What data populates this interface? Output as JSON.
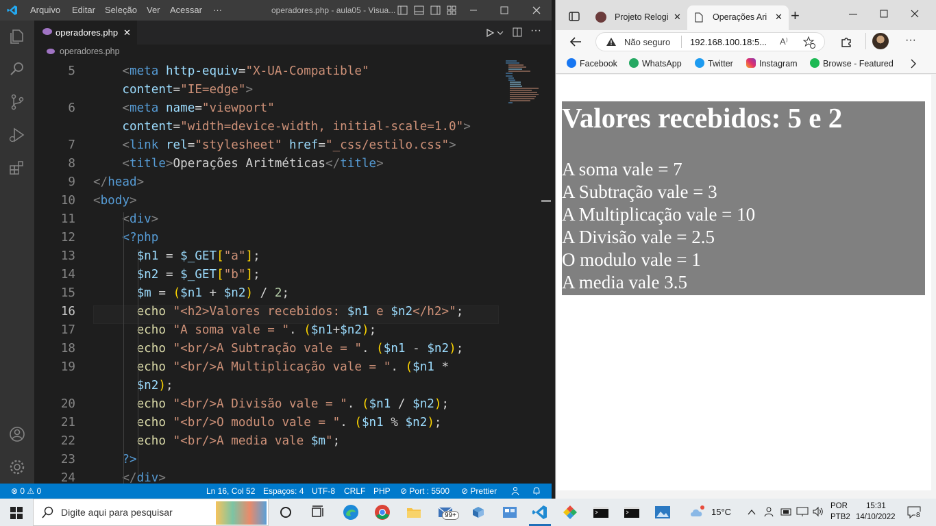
{
  "vscode": {
    "menu": [
      "Arquivo",
      "Editar",
      "Seleção",
      "Ver",
      "Acessar",
      "···"
    ],
    "window_title": "operadores.php - aula05 - Visua...",
    "tab": {
      "label": "operadores.php",
      "close": "✕"
    },
    "breadcrumb": "operadores.php",
    "lines": [
      {
        "num": "5",
        "html": "<span class='p'>&lt;</span><span class='t'>meta</span> <span class='a'>http-equiv</span>=<span class='s'>\"X-UA-Compatible\"</span>"
      },
      {
        "num": "",
        "html": "<span class='a'>content</span>=<span class='s'>\"IE=edge\"</span><span class='p'>&gt;</span>"
      },
      {
        "num": "6",
        "html": "<span class='p'>&lt;</span><span class='t'>meta</span> <span class='a'>name</span>=<span class='s'>\"viewport\"</span>"
      },
      {
        "num": "",
        "html": "<span class='a'>content</span>=<span class='s'>\"width=device-width, initial-scale=1.0\"</span><span class='p'>&gt;</span>"
      },
      {
        "num": "7",
        "html": "<span class='p'>&lt;</span><span class='t'>link</span> <span class='a'>rel</span>=<span class='s'>\"stylesheet\"</span> <span class='a'>href</span>=<span class='s'>\"_css/estilo.css\"</span><span class='p'>&gt;</span>"
      },
      {
        "num": "8",
        "html": "<span class='p'>&lt;</span><span class='t'>title</span><span class='p'>&gt;</span>Operações Aritméticas<span class='p'>&lt;/</span><span class='t'>title</span><span class='p'>&gt;</span>"
      },
      {
        "num": "9",
        "html": "<span class='p'>&lt;/</span><span class='t'>head</span><span class='p'>&gt;</span>"
      },
      {
        "num": "10",
        "html": "<span class='p'>&lt;</span><span class='t'>body</span><span class='p'>&gt;</span>"
      },
      {
        "num": "11",
        "html": "<span class='p'>&lt;</span><span class='t'>div</span><span class='p'>&gt;</span>"
      },
      {
        "num": "12",
        "html": "<span class='t'>&lt;?php</span>"
      },
      {
        "num": "13",
        "html": "<span class='v'>$n1</span> = <span class='v'>$_GET</span><span class='y'>[</span><span class='s'>\"a\"</span><span class='y'>]</span>;"
      },
      {
        "num": "14",
        "html": "<span class='v'>$n2</span> = <span class='v'>$_GET</span><span class='y'>[</span><span class='s'>\"b\"</span><span class='y'>]</span>;"
      },
      {
        "num": "15",
        "html": "<span class='v'>$m</span> = <span class='y'>(</span><span class='v'>$n1</span> + <span class='v'>$n2</span><span class='y'>)</span> / <span class='n'>2</span>;"
      },
      {
        "num": "16",
        "html": "<span class='k'>echo</span> <span class='s'>\"&lt;h2&gt;Valores recebidos: </span><span class='v'>$n1</span><span class='s'> e </span><span class='v'>$n2</span><span class='s'>&lt;/h2&gt;\"</span>;"
      },
      {
        "num": "17",
        "html": "<span class='k'>echo</span> <span class='s'>\"A soma vale = \"</span>. <span class='y'>(</span><span class='v'>$n1</span>+<span class='v'>$n2</span><span class='y'>)</span>;"
      },
      {
        "num": "18",
        "html": "<span class='k'>echo</span> <span class='s'>\"&lt;br/&gt;A Subtração vale = \"</span>. <span class='y'>(</span><span class='v'>$n1</span> - <span class='v'>$n2</span><span class='y'>)</span>;"
      },
      {
        "num": "19",
        "html": "<span class='k'>echo</span> <span class='s'>\"&lt;br/&gt;A Multiplicação vale = \"</span>. <span class='y'>(</span><span class='v'>$n1</span> *"
      },
      {
        "num": "",
        "html": "<span class='v'>$n2</span><span class='y'>)</span>;"
      },
      {
        "num": "20",
        "html": "<span class='k'>echo</span> <span class='s'>\"&lt;br/&gt;A Divisão vale = \"</span>. <span class='y'>(</span><span class='v'>$n1</span> / <span class='v'>$n2</span><span class='y'>)</span>;"
      },
      {
        "num": "21",
        "html": "<span class='k'>echo</span> <span class='s'>\"&lt;br/&gt;O modulo vale = \"</span>. <span class='y'>(</span><span class='v'>$n1</span> % <span class='v'>$n2</span><span class='y'>)</span>;"
      },
      {
        "num": "22",
        "html": "<span class='k'>echo</span> <span class='s'>\"&lt;br/&gt;A media vale </span><span class='v'>$m</span><span class='s'>\"</span>;"
      },
      {
        "num": "23",
        "html": "<span class='t'>?&gt;</span>"
      },
      {
        "num": "24",
        "html": "<span class='p'>&lt;/</span><span class='t'>div</span><span class='p'>&gt;</span>"
      }
    ],
    "status": {
      "errors": "⊗ 0 ⚠ 0",
      "position": "Ln 16, Col 52",
      "spaces": "Espaços: 4",
      "encoding": "UTF-8",
      "eol": "CRLF",
      "language": "PHP",
      "port": "⊘ Port : 5500",
      "prettier": "⊘ Prettier"
    }
  },
  "browser": {
    "tabs": [
      "Projeto Relogi",
      "Operações Ari"
    ],
    "not_secure": "Não seguro",
    "url": "192.168.100.18:5...",
    "favorites": [
      "Facebook",
      "WhatsApp",
      "Twitter",
      "Instagram",
      "Browse - Featured"
    ],
    "page": {
      "heading": "Valores recebidos: 5 e 2",
      "lines": [
        "A soma vale = 7",
        "A Subtração vale = 3",
        "A Multiplicação vale = 10",
        "A Divisão vale = 2.5",
        "O modulo vale = 1",
        "A media vale 3.5"
      ]
    }
  },
  "taskbar": {
    "search_placeholder": "Digite aqui para pesquisar",
    "badge": "99+",
    "weather": "15°C",
    "lang": "POR",
    "layout": "PTB2",
    "time": "15:31",
    "date": "14/10/2022",
    "notifications": "8"
  }
}
